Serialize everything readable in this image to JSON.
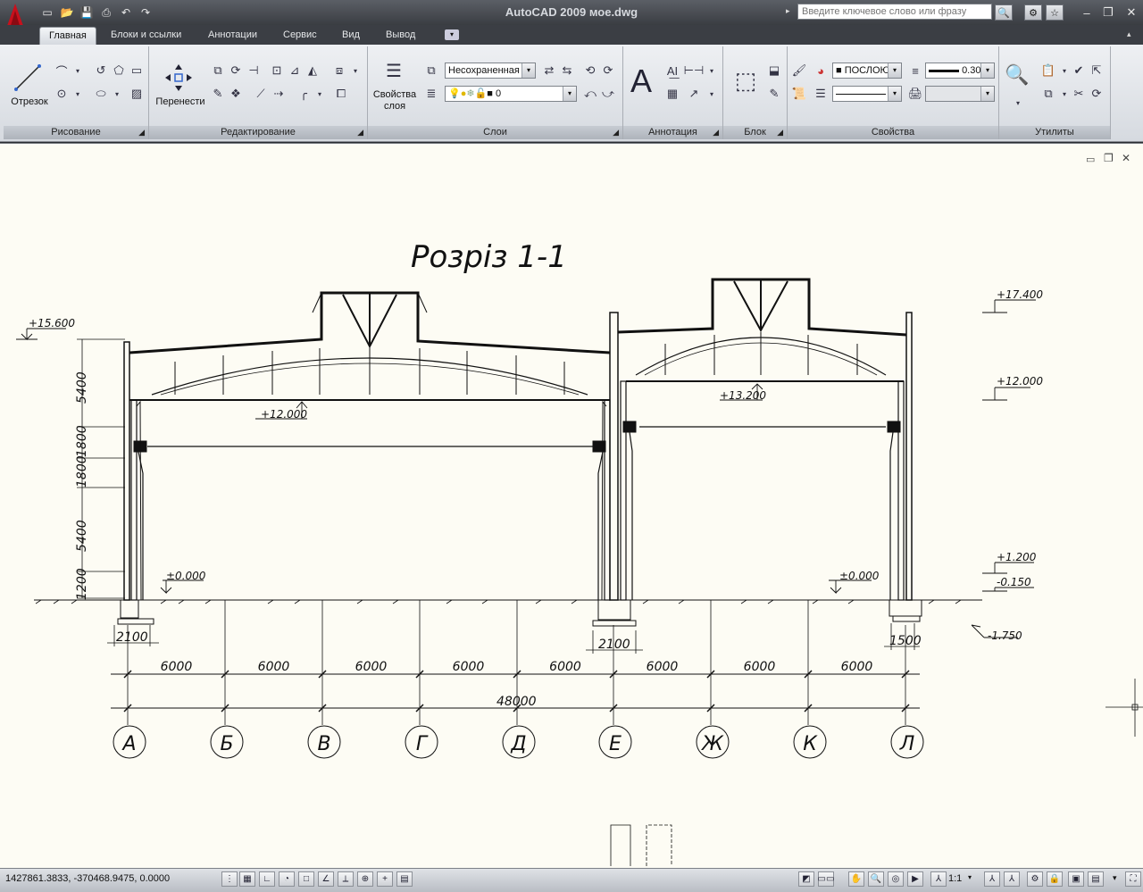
{
  "app": {
    "title": "AutoCAD 2009 мое.dwg",
    "search_placeholder": "Введите ключевое слово или фразу"
  },
  "menu_tabs": [
    {
      "label": "Главная",
      "active": true
    },
    {
      "label": "Блоки и ссылки"
    },
    {
      "label": "Аннотации"
    },
    {
      "label": "Сервис"
    },
    {
      "label": "Вид"
    },
    {
      "label": "Вывод"
    }
  ],
  "ribbon": {
    "draw": {
      "title": "Рисование",
      "line_label": "Отрезок"
    },
    "modify": {
      "title": "Редактирование",
      "move_label": "Перенести"
    },
    "layers": {
      "title": "Слои",
      "props_label_1": "Свойства",
      "props_label_2": "слоя",
      "layer_state": "Несохраненная",
      "current_layer": "0"
    },
    "annotation": {
      "title": "Аннотация"
    },
    "block": {
      "title": "Блок"
    },
    "properties": {
      "title": "Свойства",
      "color": "ПОСЛОЮ",
      "lineweight": "0.30"
    },
    "utilities": {
      "title": "Утилиты"
    }
  },
  "drawing": {
    "section_title": "Розріз 1-1",
    "axes": [
      "А",
      "Б",
      "В",
      "Г",
      "Д",
      "Е",
      "Ж",
      "К",
      "Л"
    ],
    "spans": [
      "6000",
      "6000",
      "6000",
      "6000",
      "6000",
      "6000",
      "6000",
      "6000"
    ],
    "total_length": "48000",
    "bay_widths": [
      "2100",
      "2100",
      "1500"
    ],
    "vertical_dims": [
      "5400",
      "1800",
      "1800",
      "5400",
      "1200"
    ],
    "levels": {
      "left_top": "+15.600",
      "left_truss_bottom": "+12.000",
      "left_floor": "±0.000",
      "right_truss_bottom": "+13.200",
      "right_floor": "±0.000",
      "right_top": "+17.400",
      "right_12": "+12.000",
      "right_1200": "+1.200",
      "right_m150": "-0.150",
      "right_m1750": "-1.750"
    }
  },
  "status": {
    "coordinates": "1427861.3833, -370468.9475, 0.0000",
    "scale": "1:1"
  }
}
